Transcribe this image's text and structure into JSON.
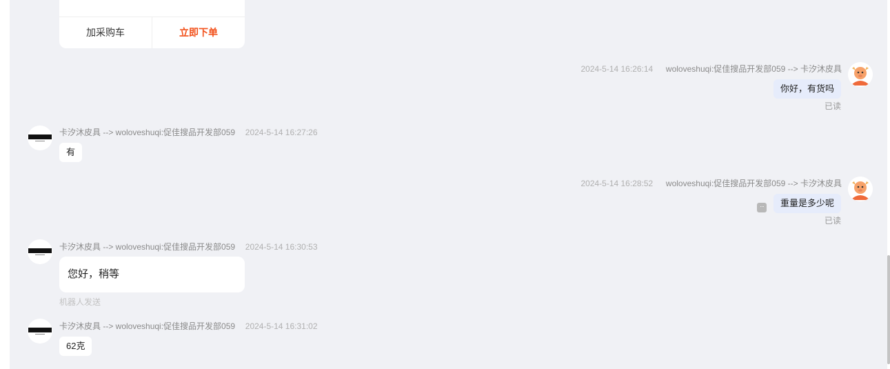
{
  "card": {
    "add_cart_label": "加采购车",
    "order_now_label": "立即下单"
  },
  "messages": [
    {
      "direction": "out",
      "time": "2024-5-14 16:26:14",
      "sender": "woloveshuqi:促佳搜品开发部059 --> 卡汐沐皮具",
      "text": "你好，有货吗",
      "status": "已读"
    },
    {
      "direction": "in",
      "sender": "卡汐沐皮具 --> woloveshuqi:促佳搜品开发部059",
      "time": "2024-5-14 16:27:26",
      "text": "有"
    },
    {
      "direction": "out",
      "time": "2024-5-14 16:28:52",
      "sender": "woloveshuqi:促佳搜品开发部059 --> 卡汐沐皮具",
      "text": "重量是多少呢",
      "status": "已读"
    },
    {
      "direction": "in",
      "sender": "卡汐沐皮具 --> woloveshuqi:促佳搜品开发部059",
      "time": "2024-5-14 16:30:53",
      "text": "您好，稍等",
      "note": "机器人发送"
    },
    {
      "direction": "in",
      "sender": "卡汐沐皮具 --> woloveshuqi:促佳搜品开发部059",
      "time": "2024-5-14 16:31:02",
      "text": "62克"
    }
  ],
  "shop_logo_text": "卡汐沐皮具",
  "icons": {
    "shop_avatar": "shop-logo-icon",
    "user_avatar": "cartoon-avatar-icon",
    "more": "more-options-icon"
  },
  "colors": {
    "accent": "#f2501a",
    "chat_bg": "#f0f1f5",
    "outgoing_bubble": "#e6ecfb"
  }
}
